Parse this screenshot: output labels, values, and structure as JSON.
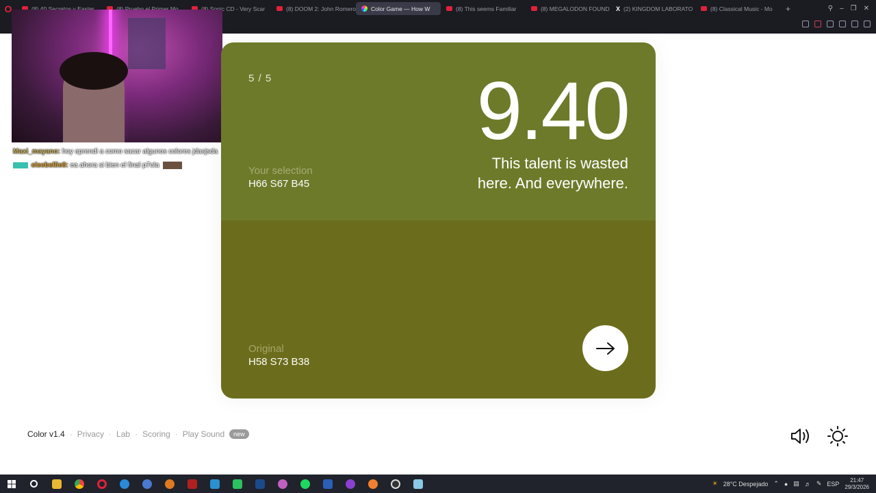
{
  "browser": {
    "tabs": [
      {
        "label": "(8) 40 Secretos y Easter",
        "icon": "youtube-icon"
      },
      {
        "label": "(8) Pruebo el Primer Mo…",
        "icon": "youtube-icon"
      },
      {
        "label": "(8) Sonic CD - Very Scar",
        "icon": "youtube-icon"
      },
      {
        "label": "(8) DOOM 2: John Romero",
        "icon": "youtube-icon"
      },
      {
        "label": "Color Game — How W",
        "icon": "color-wheel-icon",
        "active": true
      },
      {
        "label": "(8) This seems Familiar",
        "icon": "youtube-icon"
      },
      {
        "label": "(8) MEGALODON FOUND",
        "icon": "youtube-icon"
      },
      {
        "label": "(2) KINGDOM LABORATO",
        "icon": "x-icon"
      },
      {
        "label": "(8) Classical Music - Mo",
        "icon": "youtube-icon"
      }
    ],
    "new_tab": "+"
  },
  "chat": [
    {
      "user": "Maxi_mayano:",
      "message": "hoy aprendi a como sacar algunos colores jdasjsda"
    },
    {
      "user": "eleebellie8:",
      "message": "ea ahora si bien el final p7ola"
    }
  ],
  "game": {
    "round": "5 / 5",
    "score": "9.40",
    "comment_line1": "This talent is wasted",
    "comment_line2": "here. And everywhere.",
    "selection_label": "Your selection",
    "selection_value": "H66 S67 B45",
    "original_label": "Original",
    "original_value": "H58 S73 B38",
    "selection_color": "#6d7a2a",
    "original_color": "#6b6d1c"
  },
  "footer": {
    "brand": "Color v1.4",
    "links": [
      "Privacy",
      "Lab",
      "Scoring",
      "Play Sound"
    ],
    "new_badge": "new",
    "separator": "·"
  },
  "taskbar": {
    "weather": "28°C  Despejado",
    "language": "ESP",
    "time": "21:47",
    "date": "29/3/2026"
  }
}
